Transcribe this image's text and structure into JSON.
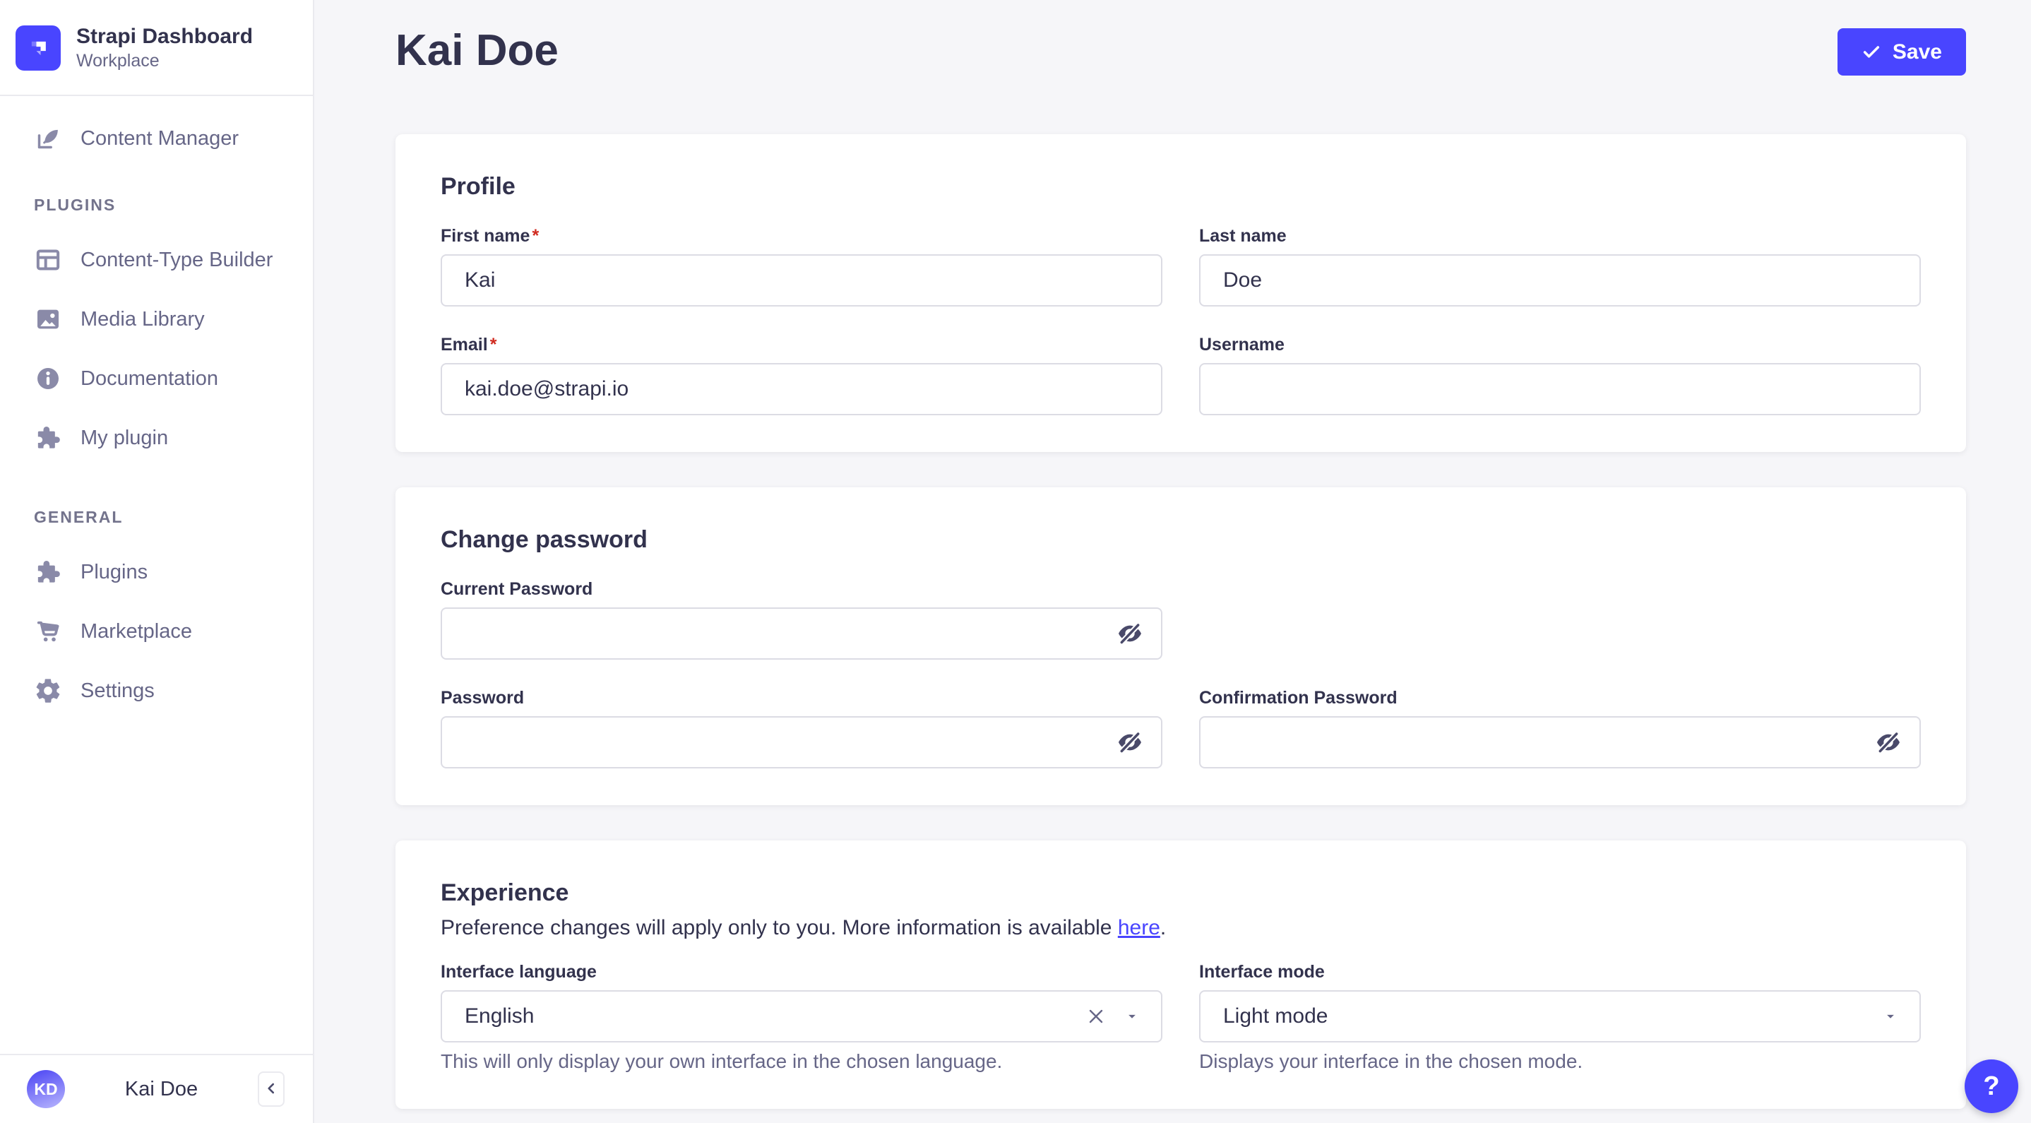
{
  "brand": {
    "name": "Strapi Dashboard",
    "workspace": "Workplace"
  },
  "sidebar": {
    "content_manager": "Content Manager",
    "plugins_section": "PLUGINS",
    "content_type_builder": "Content-Type Builder",
    "media_library": "Media Library",
    "documentation": "Documentation",
    "my_plugin": "My plugin",
    "general_section": "GENERAL",
    "plugins": "Plugins",
    "marketplace": "Marketplace",
    "settings": "Settings",
    "user_initials": "KD",
    "user_name": "Kai Doe"
  },
  "header": {
    "title": "Kai Doe",
    "save": "Save"
  },
  "profile": {
    "title": "Profile",
    "required_mark": "*",
    "first_name_label": "First name",
    "first_name_value": "Kai",
    "last_name_label": "Last name",
    "last_name_value": "Doe",
    "email_label": "Email",
    "email_value": "kai.doe@strapi.io",
    "username_label": "Username",
    "username_value": ""
  },
  "password": {
    "title": "Change password",
    "current_label": "Current Password",
    "new_label": "Password",
    "confirm_label": "Confirmation Password"
  },
  "experience": {
    "title": "Experience",
    "subtitle_prefix": "Preference changes will apply only to you. More information is available ",
    "link_text": "here",
    "subtitle_suffix": ".",
    "language_label": "Interface language",
    "language_value": "English",
    "language_helper": "This will only display your own interface in the chosen language.",
    "mode_label": "Interface mode",
    "mode_value": "Light mode",
    "mode_helper": "Displays your interface in the chosen mode."
  },
  "help": {
    "label": "?"
  },
  "colors": {
    "primary": "#4945ff",
    "danger": "#d02b20",
    "text": "#32324d",
    "muted": "#666687"
  }
}
